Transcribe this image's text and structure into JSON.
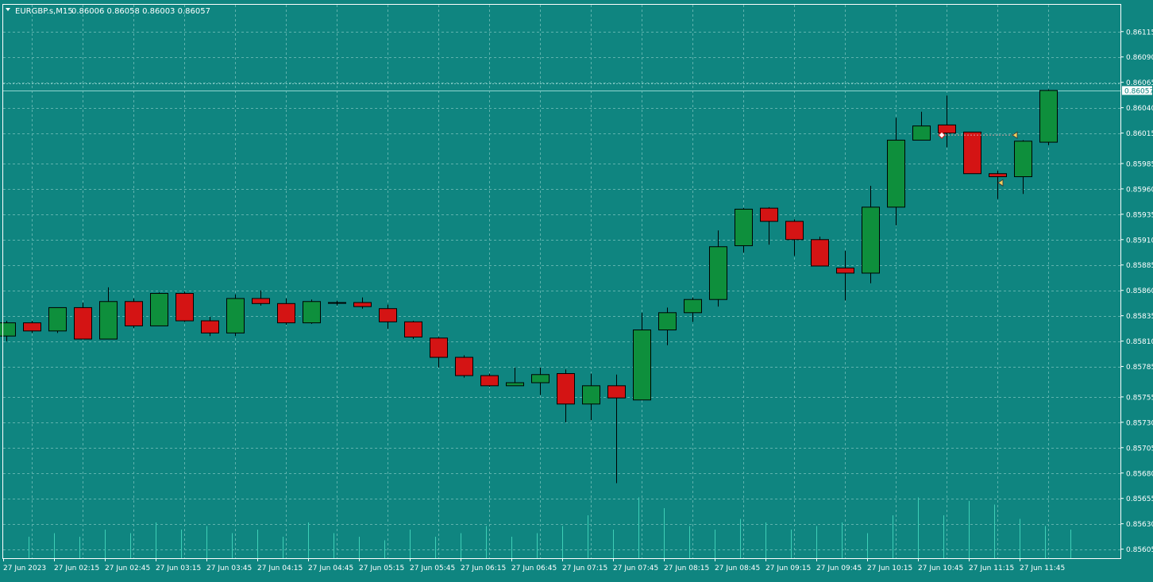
{
  "header": {
    "symbol": "EURGBP.s,M15",
    "ohlc": "0.86006 0.86058 0.86003 0.86057"
  },
  "colors": {
    "background": "#0f8580",
    "grid": "#5fb3ae",
    "bull": "#0e8f3c",
    "bear": "#d41414",
    "frame": "#ffffff",
    "text": "#ffffff",
    "volume": "#3fcfb7",
    "price_line": "#8fd4cf"
  },
  "price_label": "0.86057",
  "chart_data": {
    "type": "candlestick",
    "symbol": "EURGBP.s",
    "timeframe": "M15",
    "ylim": [
      0.856,
      0.86125
    ],
    "y_ticks": [
      "0.86115",
      "0.86090",
      "0.86065",
      "0.86040",
      "0.86015",
      "0.85985",
      "0.85960",
      "0.85935",
      "0.85910",
      "0.85885",
      "0.85860",
      "0.85835",
      "0.85810",
      "0.85785",
      "0.85755",
      "0.85730",
      "0.85705",
      "0.85680",
      "0.85655",
      "0.85630",
      "0.85605"
    ],
    "x_labels": [
      "27 Jun 2023",
      "27 Jun 02:15",
      "27 Jun 02:45",
      "27 Jun 03:15",
      "27 Jun 03:45",
      "27 Jun 04:15",
      "27 Jun 04:45",
      "27 Jun 05:15",
      "27 Jun 05:45",
      "27 Jun 06:15",
      "27 Jun 06:45",
      "27 Jun 07:15",
      "27 Jun 07:45",
      "27 Jun 08:15",
      "27 Jun 08:45",
      "27 Jun 09:15",
      "27 Jun 09:45",
      "27 Jun 10:15",
      "27 Jun 10:45",
      "27 Jun 11:15",
      "27 Jun 11:45"
    ],
    "current_price": 0.86057,
    "grid": true,
    "candles": [
      {
        "time": "01:45",
        "o": 0.85815,
        "h": 0.8583,
        "l": 0.8581,
        "c": 0.85828
      },
      {
        "time": "02:00",
        "o": 0.85828,
        "h": 0.8583,
        "l": 0.85818,
        "c": 0.8582
      },
      {
        "time": "02:15",
        "o": 0.8582,
        "h": 0.85843,
        "l": 0.85818,
        "c": 0.85843
      },
      {
        "time": "02:30",
        "o": 0.85843,
        "h": 0.85848,
        "l": 0.85812,
        "c": 0.85812
      },
      {
        "time": "02:45",
        "o": 0.85812,
        "h": 0.85863,
        "l": 0.85812,
        "c": 0.85849
      },
      {
        "time": "03:00",
        "o": 0.85849,
        "h": 0.85852,
        "l": 0.85823,
        "c": 0.85825
      },
      {
        "time": "03:15",
        "o": 0.85825,
        "h": 0.85858,
        "l": 0.85825,
        "c": 0.85857
      },
      {
        "time": "03:30",
        "o": 0.85857,
        "h": 0.85859,
        "l": 0.85829,
        "c": 0.8583
      },
      {
        "time": "03:45",
        "o": 0.8583,
        "h": 0.85834,
        "l": 0.85815,
        "c": 0.85818
      },
      {
        "time": "04:00",
        "o": 0.85818,
        "h": 0.85856,
        "l": 0.85815,
        "c": 0.85852
      },
      {
        "time": "04:15",
        "o": 0.85852,
        "h": 0.8586,
        "l": 0.85845,
        "c": 0.85847
      },
      {
        "time": "04:30",
        "o": 0.85847,
        "h": 0.85852,
        "l": 0.85826,
        "c": 0.85828
      },
      {
        "time": "04:45",
        "o": 0.85828,
        "h": 0.85851,
        "l": 0.85827,
        "c": 0.85849
      },
      {
        "time": "05:00",
        "o": 0.85848,
        "h": 0.8585,
        "l": 0.85845,
        "c": 0.85848
      },
      {
        "time": "05:15",
        "o": 0.85848,
        "h": 0.85853,
        "l": 0.85842,
        "c": 0.85844
      },
      {
        "time": "05:30",
        "o": 0.85842,
        "h": 0.85846,
        "l": 0.85822,
        "c": 0.85829
      },
      {
        "time": "05:45",
        "o": 0.85829,
        "h": 0.8583,
        "l": 0.85812,
        "c": 0.85814
      },
      {
        "time": "06:00",
        "o": 0.85813,
        "h": 0.85814,
        "l": 0.85784,
        "c": 0.85794
      },
      {
        "time": "06:15",
        "o": 0.85794,
        "h": 0.85796,
        "l": 0.85774,
        "c": 0.85776
      },
      {
        "time": "06:30",
        "o": 0.85776,
        "h": 0.85778,
        "l": 0.85765,
        "c": 0.85766
      },
      {
        "time": "06:45",
        "o": 0.85766,
        "h": 0.85784,
        "l": 0.85766,
        "c": 0.85769
      },
      {
        "time": "07:00",
        "o": 0.85769,
        "h": 0.85784,
        "l": 0.85757,
        "c": 0.85777
      },
      {
        "time": "07:15",
        "o": 0.85778,
        "h": 0.85782,
        "l": 0.8573,
        "c": 0.85748
      },
      {
        "time": "07:30",
        "o": 0.85748,
        "h": 0.85778,
        "l": 0.85732,
        "c": 0.85766
      },
      {
        "time": "07:45",
        "o": 0.85766,
        "h": 0.85777,
        "l": 0.8567,
        "c": 0.85754
      },
      {
        "time": "08:00",
        "o": 0.85752,
        "h": 0.85838,
        "l": 0.85752,
        "c": 0.85821
      },
      {
        "time": "08:15",
        "o": 0.85821,
        "h": 0.85843,
        "l": 0.85806,
        "c": 0.85838
      },
      {
        "time": "08:30",
        "o": 0.85838,
        "h": 0.85853,
        "l": 0.85829,
        "c": 0.85851
      },
      {
        "time": "08:45",
        "o": 0.85851,
        "h": 0.85919,
        "l": 0.85844,
        "c": 0.85903
      },
      {
        "time": "09:00",
        "o": 0.85904,
        "h": 0.85941,
        "l": 0.85897,
        "c": 0.8594
      },
      {
        "time": "09:15",
        "o": 0.85941,
        "h": 0.85942,
        "l": 0.85905,
        "c": 0.85928
      },
      {
        "time": "09:30",
        "o": 0.85928,
        "h": 0.8593,
        "l": 0.85894,
        "c": 0.8591
      },
      {
        "time": "09:45",
        "o": 0.8591,
        "h": 0.85913,
        "l": 0.85884,
        "c": 0.85884
      },
      {
        "time": "10:00",
        "o": 0.85882,
        "h": 0.85899,
        "l": 0.8585,
        "c": 0.85877
      },
      {
        "time": "10:15",
        "o": 0.85877,
        "h": 0.85963,
        "l": 0.85867,
        "c": 0.85942
      },
      {
        "time": "10:30",
        "o": 0.85942,
        "h": 0.8603,
        "l": 0.85924,
        "c": 0.86008
      },
      {
        "time": "10:45",
        "o": 0.86008,
        "h": 0.86036,
        "l": 0.86008,
        "c": 0.86022
      },
      {
        "time": "11:00",
        "o": 0.86023,
        "h": 0.86052,
        "l": 0.86001,
        "c": 0.86015
      },
      {
        "time": "11:15",
        "o": 0.86016,
        "h": 0.86016,
        "l": 0.85975,
        "c": 0.85975
      },
      {
        "time": "11:30",
        "o": 0.85975,
        "h": 0.85978,
        "l": 0.8595,
        "c": 0.85972
      },
      {
        "time": "11:45",
        "o": 0.85972,
        "h": 0.86008,
        "l": 0.85955,
        "c": 0.86007
      },
      {
        "time": "12:00",
        "o": 0.86006,
        "h": 0.86058,
        "l": 0.86003,
        "c": 0.86057
      }
    ],
    "volumes": [
      0.3,
      0.35,
      0.3,
      0.4,
      0.35,
      0.5,
      0.4,
      0.45,
      0.35,
      0.4,
      0.3,
      0.5,
      0.35,
      0.3,
      0.25,
      0.4,
      0.3,
      0.35,
      0.45,
      0.3,
      0.35,
      0.45,
      0.6,
      0.4,
      0.85,
      0.7,
      0.45,
      0.4,
      0.55,
      0.5,
      0.4,
      0.45,
      0.5,
      0.35,
      0.6,
      0.85,
      0.6,
      0.8,
      0.75,
      0.55,
      0.45,
      0.4
    ],
    "trade_markers": [
      {
        "kind": "entry",
        "time": "11:00",
        "price": 0.86013
      },
      {
        "kind": "exit",
        "time": "11:45",
        "price": 0.86013
      },
      {
        "kind": "exit",
        "time": "11:30",
        "price": 0.85966
      }
    ]
  }
}
